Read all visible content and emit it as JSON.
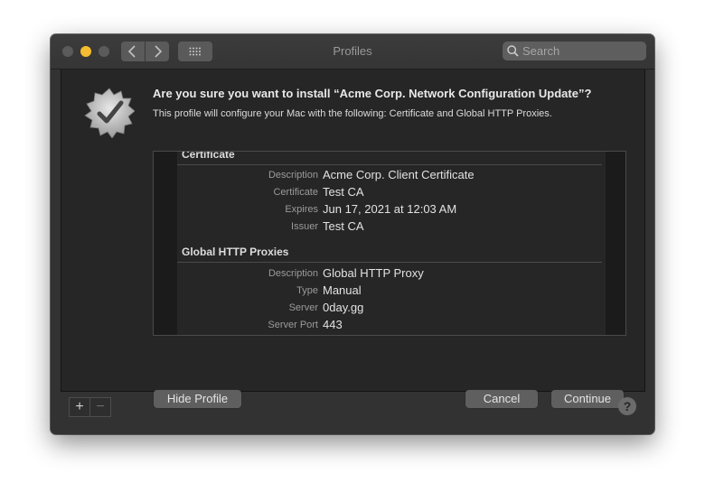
{
  "window": {
    "title": "Profiles"
  },
  "search": {
    "placeholder": "Search"
  },
  "prompt": {
    "heading": "Are you sure you want to install “Acme Corp. Network Configuration Update”?",
    "subtext": "This profile will configure your Mac with the following: Certificate and Global HTTP Proxies."
  },
  "details": {
    "certificate": {
      "title": "Certificate",
      "rows": [
        {
          "label": "Description",
          "value": "Acme Corp. Client Certificate"
        },
        {
          "label": "Certificate",
          "value": "Test CA"
        },
        {
          "label": "Expires",
          "value": "Jun 17, 2021 at 12:03 AM"
        },
        {
          "label": "Issuer",
          "value": "Test CA"
        }
      ]
    },
    "proxies": {
      "title": "Global HTTP Proxies",
      "rows": [
        {
          "label": "Description",
          "value": "Global HTTP Proxy"
        },
        {
          "label": "Type",
          "value": "Manual"
        },
        {
          "label": "Server",
          "value": "0day.gg"
        },
        {
          "label": "Server Port",
          "value": "443"
        }
      ]
    }
  },
  "buttons": {
    "hide_profile": "Hide Profile",
    "cancel": "Cancel",
    "continue": "Continue"
  },
  "footer": {
    "add": "+",
    "remove": "−",
    "help": "?"
  },
  "icons": {
    "back": "chevron-left-icon",
    "forward": "chevron-right-icon",
    "grid": "grid-icon",
    "search": "search-icon",
    "badge": "verified-checkmark-badge-icon",
    "help": "help-icon"
  },
  "colors": {
    "minimize": "#f5bd2f",
    "window_bg": "#323232",
    "sheet_bg": "#262626"
  }
}
